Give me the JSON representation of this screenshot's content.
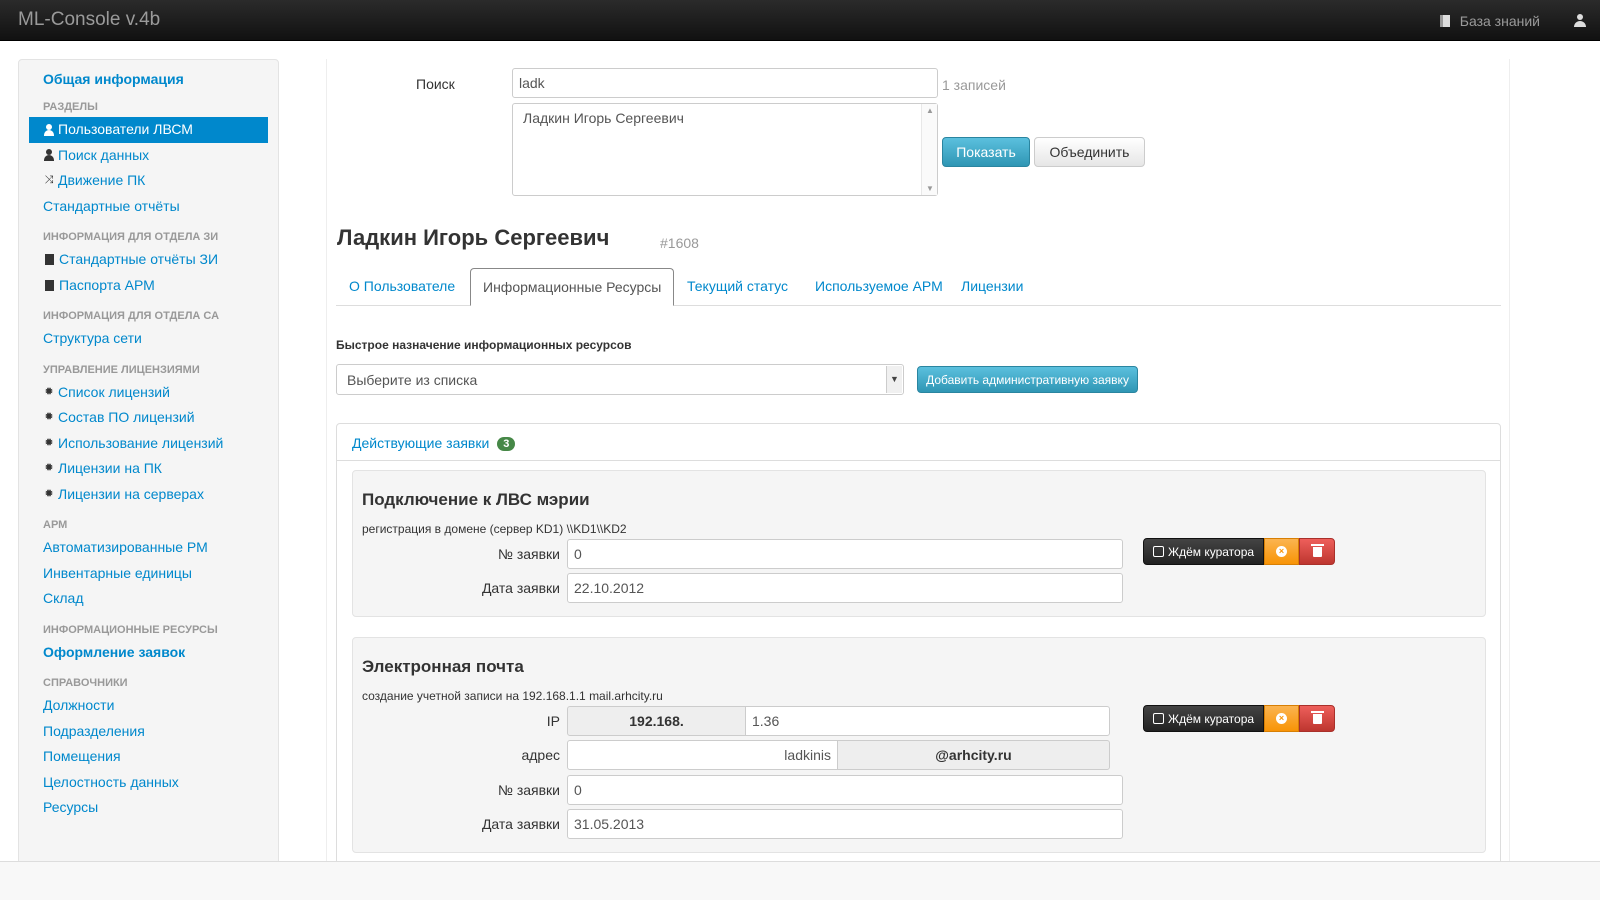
{
  "app": {
    "title": "ML-Console v.4b",
    "knowledge_base": "База знаний"
  },
  "sidebar": {
    "header": "Общая информация",
    "sections": [
      {
        "title": "РАЗДЕЛЫ",
        "items": [
          {
            "label": "Пользователи ЛВСМ",
            "icon": "user-icon",
            "active": true
          },
          {
            "label": "Поиск данных",
            "icon": "user-icon"
          },
          {
            "label": "Движение ПК",
            "icon": "shuffle-icon"
          },
          {
            "label": "Стандартные отчёты",
            "icon": ""
          }
        ]
      },
      {
        "title": "ИНФОРМАЦИЯ ДЛЯ ОТДЕЛА ЗИ",
        "items": [
          {
            "label": "Стандартные отчёты ЗИ",
            "icon": "book-icon"
          },
          {
            "label": "Паспорта АРМ",
            "icon": "book-icon"
          }
        ]
      },
      {
        "title": "ИНФОРМАЦИЯ ДЛЯ ОТДЕЛА СА",
        "items": [
          {
            "label": "Структура сети",
            "icon": ""
          }
        ]
      },
      {
        "title": "УПРАВЛЕНИЕ ЛИЦЕНЗИЯМИ",
        "items": [
          {
            "label": "Список лицензий",
            "icon": "certificate-icon"
          },
          {
            "label": "Состав ПО лицензий",
            "icon": "certificate-icon"
          },
          {
            "label": "Использование лицензий",
            "icon": "certificate-icon"
          },
          {
            "label": "Лицензии на ПК",
            "icon": "certificate-icon"
          },
          {
            "label": "Лицензии на серверах",
            "icon": "certificate-icon"
          }
        ]
      },
      {
        "title": "АРМ",
        "items": [
          {
            "label": "Автоматизированные РМ",
            "icon": ""
          },
          {
            "label": "Инвентарные единицы",
            "icon": ""
          },
          {
            "label": "Склад",
            "icon": ""
          }
        ]
      },
      {
        "title": "ИНФОРМАЦИОННЫЕ РЕСУРСЫ",
        "items": [
          {
            "label": "Оформление заявок",
            "icon": "",
            "bold": true
          }
        ]
      },
      {
        "title": "СПРАВОЧНИКИ",
        "items": [
          {
            "label": "Должности",
            "icon": ""
          },
          {
            "label": "Подразделения",
            "icon": ""
          },
          {
            "label": "Помещения",
            "icon": ""
          },
          {
            "label": "Целостность данных",
            "icon": ""
          },
          {
            "label": "Ресурсы",
            "icon": ""
          }
        ]
      }
    ]
  },
  "search": {
    "label": "Поиск",
    "value": "ladk",
    "count": "1 записей",
    "results": [
      "Ладкин Игорь Сергеевич"
    ],
    "show_button": "Показать",
    "merge_button": "Объединить"
  },
  "user": {
    "name": "Ладкин Игорь Сергеевич",
    "id": "#1608"
  },
  "tabs": [
    {
      "label": "О Пользователе",
      "active": false
    },
    {
      "label": "Информационные Ресурсы",
      "active": true
    },
    {
      "label": "Текущий статус",
      "active": false
    },
    {
      "label": "Используемое АРМ",
      "active": false
    },
    {
      "label": "Лицензии",
      "active": false
    }
  ],
  "quick_assign": {
    "label": "Быстрое назначение информационных ресурсов",
    "select_value": "Выберите из списка",
    "add_button": "Добавить административную заявку"
  },
  "requests": {
    "title": "Действующие заявки",
    "count": "3",
    "items": [
      {
        "title": "Подключение к ЛВС мэрии",
        "subtitle": "регистрация в домене (сервер KD1) \\\\KD1\\\\KD2",
        "number_label": "№ заявки",
        "number": "0",
        "date_label": "Дата заявки",
        "date": "22.10.2012",
        "status": "Ждём куратора"
      },
      {
        "title": "Электронная почта",
        "subtitle": "создание учетной записи на 192.168.1.1 mail.arhcity.ru",
        "ip_label": "IP",
        "ip_prefix": "192.168.",
        "ip_suffix": "1.36",
        "address_label": "адрес",
        "address_user": "ladkinis",
        "address_domain": "@arhcity.ru",
        "number_label": "№ заявки",
        "number": "0",
        "date_label": "Дата заявки",
        "date": "31.05.2013",
        "status": "Ждём куратора"
      }
    ]
  },
  "colors": {
    "link": "#0088cc",
    "primary": "#49afcd",
    "badge": "#468847",
    "warning": "#f89406",
    "danger": "#bd362f"
  }
}
